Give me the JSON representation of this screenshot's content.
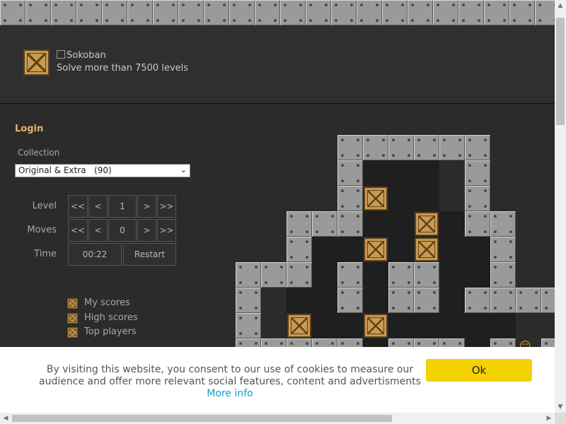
{
  "header": {
    "logo_alt": "Sokoban",
    "tagline": "Solve more than 7500 levels"
  },
  "sidebar": {
    "login_label": "Login",
    "collection_label": "Collection",
    "collection_value": "Original & Extra   (90)",
    "level_label": "Level",
    "moves_label": "Moves",
    "time_label": "Time",
    "level_value": "1",
    "moves_value": "0",
    "time_value": "00:22",
    "restart_label": "Restart",
    "nav_first": "<<",
    "nav_prev": "<",
    "nav_next": ">",
    "nav_last": ">>",
    "score_links": [
      "My scores",
      "High scores",
      "Top players"
    ]
  },
  "cookie_banner": {
    "text": "By visiting this website, you consent to our use of cookies to measure our audience and offer more relevant social features, content and advertisments",
    "more_info": "More info",
    "ok_label": "Ok"
  },
  "colors": {
    "accent": "#e3b768",
    "ok_button": "#f4d100",
    "link": "#1a9bd0"
  },
  "icons": [
    "crate-icon",
    "player-icon",
    "chevron-down-icon"
  ]
}
